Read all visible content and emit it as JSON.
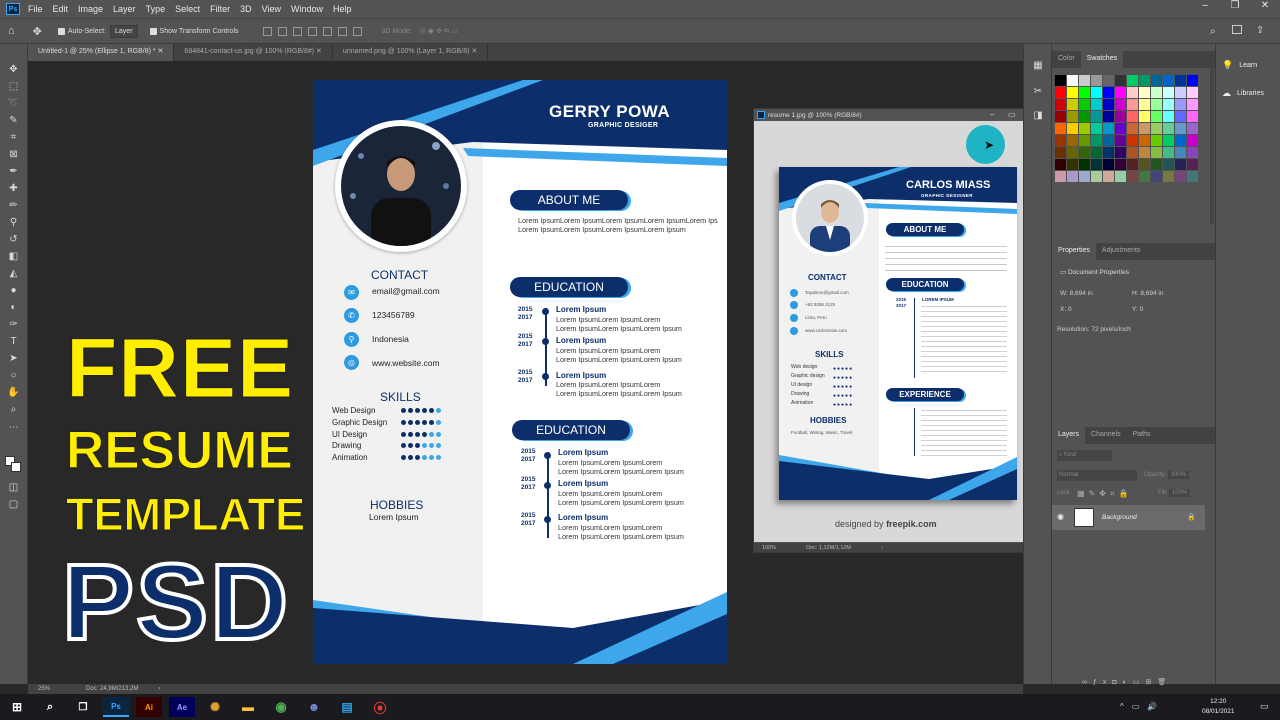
{
  "menubar": {
    "app_icon": "Ps",
    "items": [
      "File",
      "Edit",
      "Image",
      "Layer",
      "Type",
      "Select",
      "Filter",
      "3D",
      "View",
      "Window",
      "Help"
    ]
  },
  "options": {
    "auto_select": "Auto-Select:",
    "layer": "Layer",
    "show_transform": "Show Transform Controls",
    "mode_3d": "3D Mode:"
  },
  "tabs": [
    "Untitled-1 @ 25% (Ellipse 1, RGB/8) *",
    "684841-contact-us.jpg @ 100% (RGB/8#)",
    "unnamed.png @ 100% (Layer 1, RGB/8)"
  ],
  "resume": {
    "name": "GERRY POWA",
    "role": "GRAPHIC DESIGER",
    "about_title": "ABOUT ME",
    "about_text": [
      "Lorem IpsumLorem IpsumLorem IpsumLorem IpsumLorem Ips",
      "Lorem IpsumLorem IpsumLorem IpsumLorem Ipsum"
    ],
    "contact_title": "CONTACT",
    "contacts": [
      "email@gmail.com",
      "123456789",
      "Indonesia",
      "www.website.com"
    ],
    "skills_title": "SKILLS",
    "skills": [
      {
        "name": "Web Design",
        "level": 5
      },
      {
        "name": "Graphic Design",
        "level": 5
      },
      {
        "name": "UI Design",
        "level": 4
      },
      {
        "name": "Drawing",
        "level": 3
      },
      {
        "name": "Animation",
        "level": 3
      }
    ],
    "hobbies_title": "HOBBIES",
    "hobbies_text": "Lorem Ipsum",
    "education_title": "EDUCATION",
    "education": [
      {
        "y1": "2015",
        "y2": "2017",
        "title": "Lorem Ipsum",
        "line1": "Lorem IpsumLorem IpsumLorem",
        "line2": "Lorem IpsumLorem IpsumLorem Ipsum"
      },
      {
        "y1": "2015",
        "y2": "2017",
        "title": "Lorem Ipsum",
        "line1": "Lorem IpsumLorem IpsumLorem",
        "line2": "Lorem IpsumLorem IpsumLorem Ipsum"
      },
      {
        "y1": "2015",
        "y2": "2017",
        "title": "Lorem Ipsum",
        "line1": "Lorem IpsumLorem IpsumLorem",
        "line2": "Lorem IpsumLorem IpsumLorem Ipsum"
      }
    ],
    "education2_title": "EDUCATION",
    "education2": [
      {
        "y1": "2015",
        "y2": "2017",
        "title": "Lorem Ipsum",
        "line1": "Lorem IpsumLorem IpsumLorem",
        "line2": "Lorem IpsumLorem IpsumLorem Ipsum"
      },
      {
        "y1": "2015",
        "y2": "2017",
        "title": "Lorem Ipsum",
        "line1": "Lorem IpsumLorem IpsumLorem",
        "line2": "Lorem IpsumLorem IpsumLorem Ipsum"
      },
      {
        "y1": "2015",
        "y2": "2017",
        "title": "Lorem Ipsum",
        "line1": "Lorem IpsumLorem IpsumLorem",
        "line2": "Lorem IpsumLorem IpsumLorem Ipsum"
      }
    ]
  },
  "overlay": {
    "line1": "FREE",
    "line2": "RESUME",
    "line3": "TEMPLATE",
    "line4": "PSD"
  },
  "float_window": {
    "title": "resume 1.jpg @ 100% (RGB/8#)",
    "zoom": "100%",
    "doc": "Doc: 1,12M/1,12M",
    "credit": "designed by",
    "credit_brand": "freepik.com",
    "resume": {
      "name": "CARLOS MIASS",
      "role": "GRAPHIC DESIGNER",
      "about": "ABOUT ME",
      "contact": "CONTACT",
      "contacts": [
        "Tayabron@gmail.com",
        "+62 9256 2125",
        "Lima, Peru",
        "www.carlosmias.com"
      ],
      "skills_title": "SKILLS",
      "skills": [
        "Web design",
        "Graphic design",
        "UI design",
        "Drawing",
        "Animation"
      ],
      "hobbies_title": "HOBBIES",
      "hobbies": "Football, Writing, Music, Travel",
      "education": "EDUCATION",
      "experience": "EXPERIENCE",
      "years": [
        "2015",
        "2017"
      ],
      "entry_title": "LOREM IPSUM"
    }
  },
  "panels": {
    "color_tab": "Color",
    "swatches_tab": "Swatches",
    "properties_tab": "Properties",
    "adjustments_tab": "Adjustments",
    "doc_props": "Document Properties",
    "w_label": "W:",
    "w_val": "8,694 in",
    "h_label": "H:",
    "h_val": "8,694 in",
    "x_label": "X:",
    "x_val": "0",
    "y_label": "Y:",
    "y_val": "0",
    "resolution": "Resolution: 72 pixels/inch",
    "layers_tab": "Layers",
    "channels_tab": "Channels",
    "paths_tab": "Paths",
    "kind": "Kind",
    "normal": "Normal",
    "opacity": "Opacity:",
    "opacity_val": "100%",
    "lock": "Lock:",
    "fill": "Fill:",
    "fill_val": "100%",
    "layer_name": "Background",
    "learn": "Learn",
    "libraries": "Libraries"
  },
  "status": {
    "zoom": "25%",
    "doc": "Doc: 24,9M/213,2M"
  },
  "taskbar": {
    "time": "12:20",
    "date": "08/01/2021"
  },
  "colors": {
    "navy": "#0c2f6b",
    "blue": "#3ea6ea",
    "yellow": "#ffee00",
    "ps_bg": "#535353"
  }
}
